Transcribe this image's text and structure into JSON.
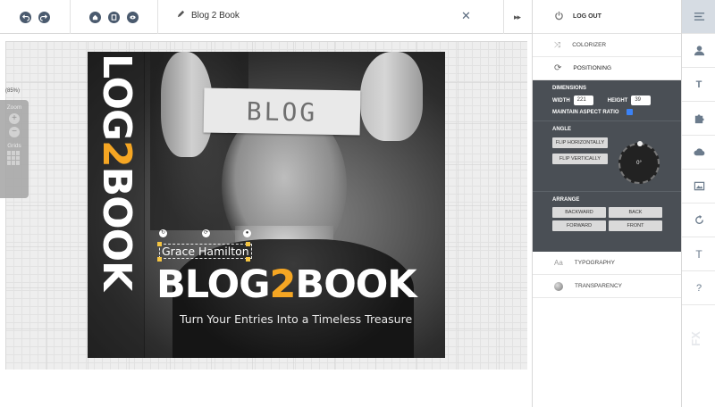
{
  "toolbar": {
    "title": "Blog 2 Book",
    "close_icon": "close-icon",
    "more_icon": "double-chevron-right-icon",
    "icons": [
      "undo-icon",
      "redo-icon",
      "home-icon",
      "pages-icon",
      "preview-icon",
      "pencil-icon"
    ]
  },
  "canvas": {
    "zoom_percent": "(85%)",
    "zoom_label": "Zoom",
    "zoom_in": "+",
    "zoom_out": "−",
    "grids_label": "Grids"
  },
  "cover": {
    "photo_text": "BLOG",
    "spine_part1": "LOG",
    "spine_part2": "2",
    "spine_part3": "BOOK",
    "author": "Grace Hamilton",
    "title_part1": "BLOG",
    "title_part2": "2",
    "title_part3": "BOOK",
    "subtitle": "Turn Your Entries Into a Timeless Treasure",
    "accent_color": "#f5a623"
  },
  "panel": {
    "logout": "LOG OUT",
    "colorizer": "COLORIZER",
    "positioning": "POSITIONING",
    "dimensions": {
      "header": "DIMENSIONS",
      "width_label": "WIDTH",
      "width_value": "221",
      "height_label": "HEIGHT",
      "height_value": "39",
      "aspect_label": "MAINTAIN ASPECT RATIO",
      "aspect_checked": true
    },
    "angle": {
      "header": "ANGLE",
      "flip_h": "FLIP HORIZONTALLY",
      "flip_v": "FLIP VERTICALLY",
      "value": "0°"
    },
    "arrange": {
      "header": "ARRANGE",
      "backward": "BACKWARD",
      "back": "BACK",
      "forward": "FORWARD",
      "front": "FRONT"
    },
    "typography": "TYPOGRAPHY",
    "typography_icon": "Aa",
    "transparency": "TRANSPARENCY"
  },
  "iconbar": {
    "items": [
      "menu-icon",
      "user-icon",
      "text-icon",
      "puzzle-icon",
      "cloud-icon",
      "image-icon",
      "refresh-icon",
      "title-icon",
      "help-icon"
    ],
    "text_glyph": "T",
    "help_glyph": "?",
    "fx_label": "FX"
  }
}
